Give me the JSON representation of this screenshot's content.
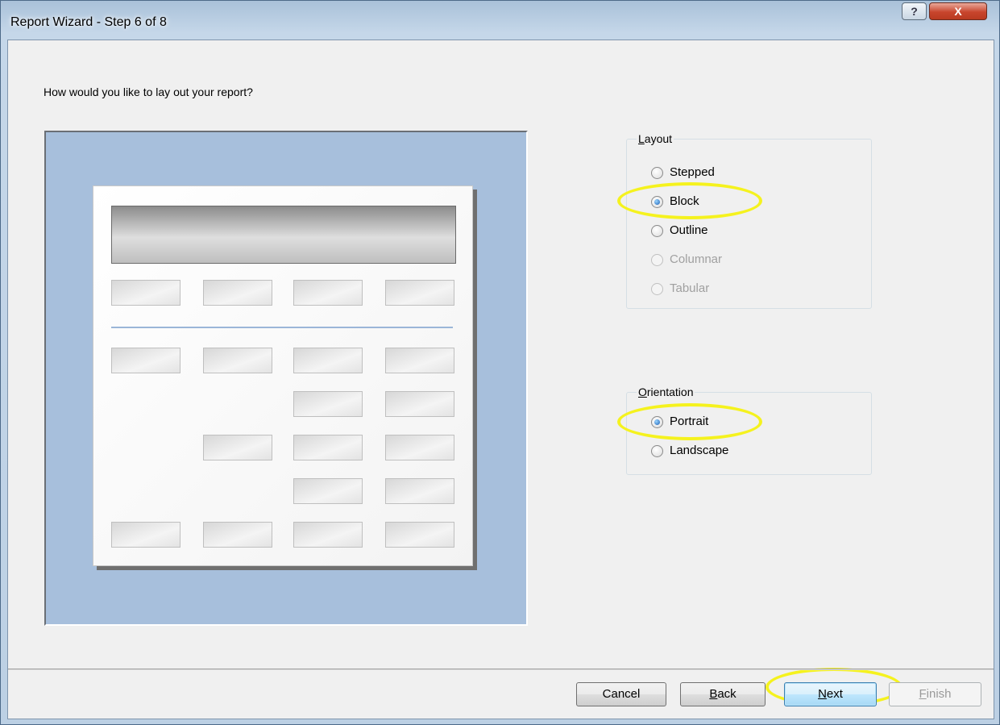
{
  "window": {
    "title": "Report Wizard - Step 6 of 8",
    "help_label": "?",
    "close_label": "X"
  },
  "question": "How would you like to lay out your report?",
  "layout": {
    "legend": "Layout",
    "options": [
      {
        "label": "Stepped",
        "checked": false,
        "enabled": true
      },
      {
        "label": "Block",
        "checked": true,
        "enabled": true
      },
      {
        "label": "Outline",
        "checked": false,
        "enabled": true
      },
      {
        "label": "Columnar",
        "checked": false,
        "enabled": false
      },
      {
        "label": "Tabular",
        "checked": false,
        "enabled": false
      }
    ]
  },
  "orientation": {
    "legend": "Orientation",
    "options": [
      {
        "label": "Portrait",
        "checked": true,
        "enabled": true
      },
      {
        "label": "Landscape",
        "checked": false,
        "enabled": true
      }
    ]
  },
  "buttons": {
    "cancel": "Cancel",
    "back": "Back",
    "next": "Next",
    "finish": "Finish"
  },
  "colors": {
    "highlight": "#f5f21e",
    "preview_background": "#a7bfdc"
  }
}
